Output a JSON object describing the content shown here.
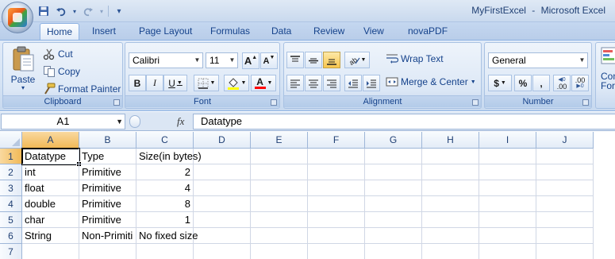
{
  "window": {
    "title_doc": "MyFirstExcel",
    "title_sep": "-",
    "title_app": "Microsoft Excel"
  },
  "qat": {
    "icons": [
      "save-icon",
      "undo-icon",
      "redo-icon",
      "customize-icon"
    ]
  },
  "tabs": [
    {
      "label": "Home",
      "active": true
    },
    {
      "label": "Insert"
    },
    {
      "label": "Page Layout"
    },
    {
      "label": "Formulas"
    },
    {
      "label": "Data"
    },
    {
      "label": "Review"
    },
    {
      "label": "View"
    },
    {
      "label": "novaPDF"
    }
  ],
  "ribbon": {
    "clipboard": {
      "label": "Clipboard",
      "paste": "Paste",
      "cut": "Cut",
      "copy": "Copy",
      "format_painter": "Format Painter"
    },
    "font": {
      "label": "Font",
      "family": "Calibri",
      "size": "11",
      "grow": "A",
      "shrink": "A",
      "bold": "B",
      "italic": "I",
      "underline": "U",
      "font_color_glyph": "A"
    },
    "alignment": {
      "label": "Alignment",
      "wrap_text": "Wrap Text",
      "merge_center": "Merge & Center"
    },
    "number": {
      "label": "Number",
      "format": "General",
      "currency": "$",
      "percent": "%",
      "comma": ",",
      "inc_decimal": ".00",
      "dec_decimal": ".00"
    },
    "styles": {
      "partial_label_1": "Con",
      "partial_label_2": "Forn"
    }
  },
  "formula_bar": {
    "name_box": "A1",
    "fx": "fx",
    "content": "Datatype"
  },
  "grid": {
    "columns": [
      "A",
      "B",
      "C",
      "D",
      "E",
      "F",
      "G",
      "H",
      "I",
      "J"
    ],
    "rows": [
      "1",
      "2",
      "3",
      "4",
      "5",
      "6",
      "7"
    ],
    "selected_cell": "A1",
    "cells": [
      [
        "Datatype",
        "Type",
        "Size(in bytes)"
      ],
      [
        "int",
        "Primitive",
        "2"
      ],
      [
        "float",
        "Primitive",
        "4"
      ],
      [
        "double",
        "Primitive",
        "8"
      ],
      [
        "char",
        "Primitive",
        "1"
      ],
      [
        "String",
        "Non-Primiti",
        "No fixed size"
      ],
      [
        "",
        "",
        ""
      ]
    ]
  }
}
